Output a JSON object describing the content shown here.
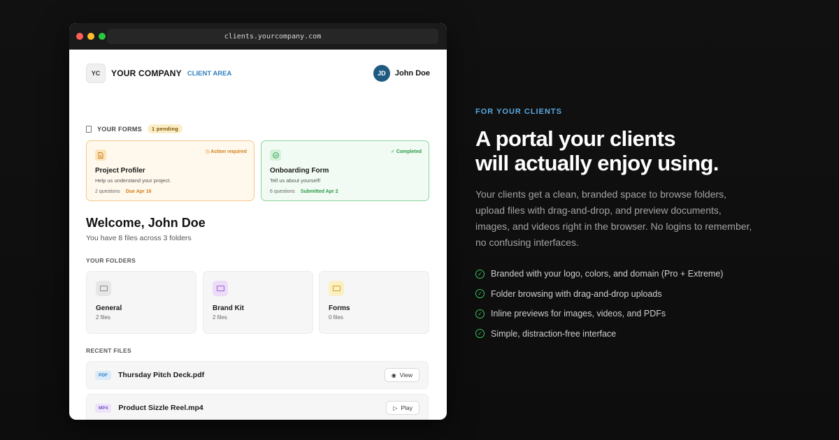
{
  "browser": {
    "url": "clients.yourcompany.com"
  },
  "header": {
    "logo_text": "YC",
    "company": "YOUR COMPANY",
    "client_area": "CLIENT AREA",
    "avatar_initials": "JD",
    "user_name": "John Doe"
  },
  "forms": {
    "title": "YOUR FORMS",
    "pending_badge": "1 pending",
    "cards": [
      {
        "badge": "Action required",
        "badge_icon": "clock-icon",
        "icon": "document-icon",
        "title": "Project Profiler",
        "description": "Help us understand your project.",
        "questions": "2 questions",
        "status": "Due Apr 16",
        "accent": "#d3801b"
      },
      {
        "badge": "Completed",
        "badge_icon": "check-circle-icon",
        "icon": "check-icon",
        "title": "Onboarding Form",
        "description": "Tell us about yourself!",
        "questions": "6 questions",
        "status": "Submitted Apr 2",
        "accent": "#2d9a48"
      }
    ]
  },
  "welcome": {
    "title": "Welcome, John Doe",
    "subtitle": "You have 8 files across 3 folders"
  },
  "folders": {
    "title": "YOUR FOLDERS",
    "items": [
      {
        "name": "General",
        "count": "2 files",
        "color": "#8a8a8a"
      },
      {
        "name": "Brand Kit",
        "count": "2 files",
        "color": "#9a5fd0"
      },
      {
        "name": "Forms",
        "count": "0 files",
        "color": "#d6a01f"
      }
    ]
  },
  "recent": {
    "title": "RECENT FILES",
    "files": [
      {
        "type": "PDF",
        "name": "Thursday Pitch Deck.pdf",
        "action": "View",
        "action_icon": "eye-icon"
      },
      {
        "type": "MP4",
        "name": "Product Sizzle Reel.mp4",
        "action": "Play",
        "action_icon": "play-icon"
      }
    ]
  },
  "marketing": {
    "eyebrow": "FOR YOUR CLIENTS",
    "headline_line1": "A portal your clients",
    "headline_line2": "will actually enjoy using.",
    "paragraph": "Your clients get a clean, branded space to browse folders, upload files with drag-and-drop, and preview documents, images, and videos right in the browser. No logins to remember, no confusing interfaces.",
    "features": [
      "Branded with your logo, colors, and domain (Pro + Extreme)",
      "Folder browsing with drag-and-drop uploads",
      "Inline previews for images, videos, and PDFs",
      "Simple, distraction-free interface"
    ]
  }
}
